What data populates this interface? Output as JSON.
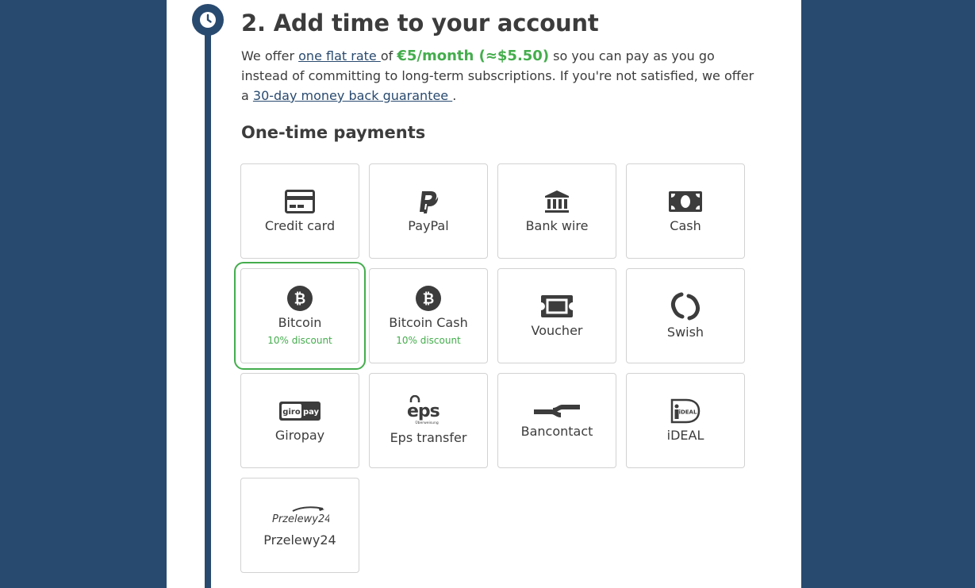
{
  "step": {
    "title": "2. Add time to your account",
    "intro": {
      "part1": "We offer ",
      "flat_rate_link": "one flat rate ",
      "part2": "of ",
      "price": "€5/month (≈$5.50)",
      "part3": " so you can pay as you go instead of committing to long-term subscriptions. If you're not satisfied, we offer a ",
      "guarantee_link": "30-day money back guarantee ",
      "part4": "."
    }
  },
  "payments": {
    "section_title": "One-time payments",
    "methods": [
      {
        "label": "Credit card",
        "icon": "credit-card-icon"
      },
      {
        "label": "PayPal",
        "icon": "paypal-icon"
      },
      {
        "label": "Bank wire",
        "icon": "bank-icon"
      },
      {
        "label": "Cash",
        "icon": "cash-icon"
      },
      {
        "label": "Bitcoin",
        "icon": "bitcoin-icon",
        "discount": "10% discount",
        "selected": true
      },
      {
        "label": "Bitcoin Cash",
        "icon": "bitcoin-cash-icon",
        "discount": "10% discount"
      },
      {
        "label": "Voucher",
        "icon": "voucher-icon"
      },
      {
        "label": "Swish",
        "icon": "swish-icon"
      },
      {
        "label": "Giropay",
        "icon": "giropay-icon",
        "logo_text": "giro pay"
      },
      {
        "label": "Eps transfer",
        "icon": "eps-icon",
        "logo_text": "eps",
        "logo_subtext": "Überweisung"
      },
      {
        "label": "Bancontact",
        "icon": "bancontact-icon"
      },
      {
        "label": "iDEAL",
        "icon": "ideal-icon",
        "logo_text": "iDEAL"
      },
      {
        "label": "Przelewy24",
        "icon": "przelewy24-icon",
        "logo_text": "Przelewy24"
      }
    ]
  },
  "colors": {
    "navy": "#294a6f",
    "green": "#44ad4d",
    "text": "#3c3c3c"
  }
}
